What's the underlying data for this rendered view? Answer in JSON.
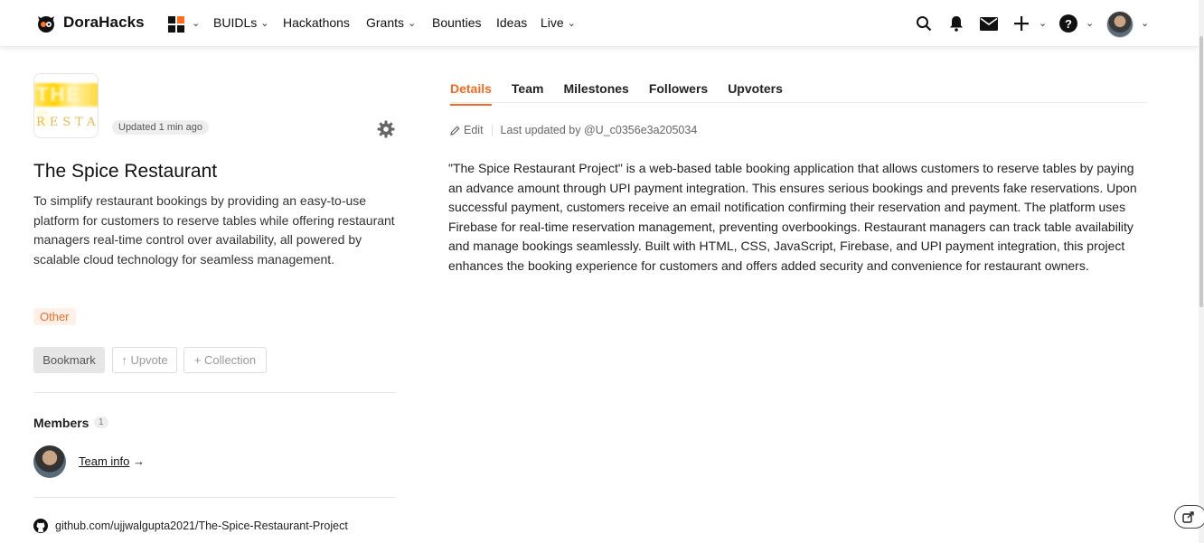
{
  "nav": {
    "brand": "DoraHacks",
    "items": [
      {
        "label": "BUIDLs",
        "dropdown": true
      },
      {
        "label": "Hackathons",
        "dropdown": false
      },
      {
        "label": "Grants",
        "dropdown": true
      },
      {
        "label": "Bounties",
        "dropdown": false
      },
      {
        "label": "Ideas",
        "dropdown": false
      },
      {
        "label": "Live",
        "dropdown": true
      }
    ],
    "icons": [
      "search-icon",
      "bell-icon",
      "mail-icon",
      "plus-icon",
      "help-icon",
      "avatar"
    ]
  },
  "project": {
    "updated": "Updated 1 min ago",
    "title": "The Spice Restaurant",
    "description": "To simplify restaurant bookings by providing an easy-to-use platform for customers to reserve tables while offering restaurant managers real-time control over availability, all powered by scalable cloud technology for seamless management.",
    "tag": "Other",
    "buttons": {
      "bookmark": "Bookmark",
      "upvote": "↑ Upvote",
      "collection": "+ Collection"
    },
    "members_label": "Members",
    "members_count": "1",
    "team_info": "Team info",
    "team_arrow": "→",
    "github": "github.com/ujjwalgupta2021/The-Spice-Restaurant-Project",
    "logo_text_top": "THE S",
    "logo_text_bottom": "RESTA"
  },
  "tabs": [
    {
      "label": "Details",
      "active": true
    },
    {
      "label": "Team",
      "active": false
    },
    {
      "label": "Milestones",
      "active": false
    },
    {
      "label": "Followers",
      "active": false
    },
    {
      "label": "Upvoters",
      "active": false
    }
  ],
  "detail": {
    "edit": "Edit",
    "last_updated": "Last updated by @U_c0356e3a205034",
    "body": "\"The Spice Restaurant Project\" is a web-based table booking application that allows customers to reserve tables by paying an advance amount through UPI payment integration. This ensures serious bookings and prevents fake reservations. Upon successful payment, customers receive an email notification confirming their reservation and payment. The platform uses Firebase for real-time reservation management, preventing overbookings. Restaurant managers can track table availability and manage bookings seamlessly. Built with HTML, CSS, JavaScript, Firebase, and UPI payment integration, this project enhances the booking experience for customers and offers added security and convenience for restaurant owners."
  },
  "colors": {
    "accent": "#f26b21",
    "tag_bg": "#fff1e8",
    "tag_fg": "#ee6b2b"
  }
}
